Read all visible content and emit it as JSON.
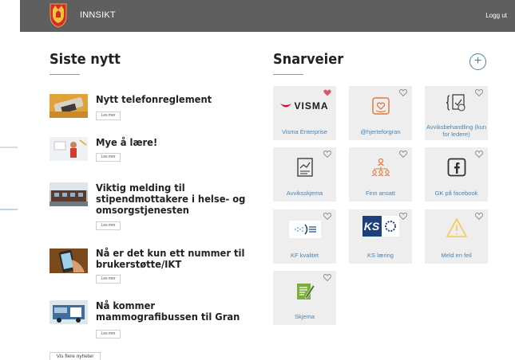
{
  "header": {
    "app_title": "INNSIKT",
    "logout_label": "Logg ut"
  },
  "news": {
    "title": "Siste nytt",
    "read_more": "Les mer",
    "more_button": "Vis flere nyheter",
    "items": [
      {
        "title": "Nytt telefonreglement"
      },
      {
        "title": "Mye å lære!"
      },
      {
        "title": "Viktig melding til stipendmottakere i helse- og omsorgstjenesten"
      },
      {
        "title": "Nå er det kun ett nummer til brukerstøtte/IKT"
      },
      {
        "title": "Nå kommer mammografibussen til Gran"
      }
    ]
  },
  "shortcuts": {
    "title": "Snarveier",
    "add_label": "+",
    "tiles": [
      {
        "label": "Visma Enterprise",
        "icon": "visma-logo",
        "favorite": true,
        "logo_text": "VISMA"
      },
      {
        "label": "@hjerteforgran",
        "icon": "heart-in-hands-icon",
        "favorite": false
      },
      {
        "label": "Avviksbehandling (kun for ledere)",
        "icon": "document-review-icon",
        "favorite": false
      },
      {
        "label": "Avviksskjema",
        "icon": "form-chart-icon",
        "favorite": false
      },
      {
        "label": "Finn ansatt",
        "icon": "org-chart-icon",
        "favorite": false
      },
      {
        "label": "GK på facebook",
        "icon": "facebook-icon",
        "favorite": false
      },
      {
        "label": "KF kvalitet",
        "icon": "kf-logo",
        "favorite": false
      },
      {
        "label": "KS læring",
        "icon": "ks-logo",
        "favorite": false,
        "logo_text": "KS"
      },
      {
        "label": "Meld en feil",
        "icon": "warning-icon",
        "favorite": false
      },
      {
        "label": "Skjema",
        "icon": "form-edit-icon",
        "favorite": false
      }
    ]
  },
  "colors": {
    "topbar": "#5f5f5f",
    "accent": "#5aaed8",
    "link": "#4d84b0",
    "tile_bg": "#eeeeee",
    "heart_active": "#e0556a"
  }
}
